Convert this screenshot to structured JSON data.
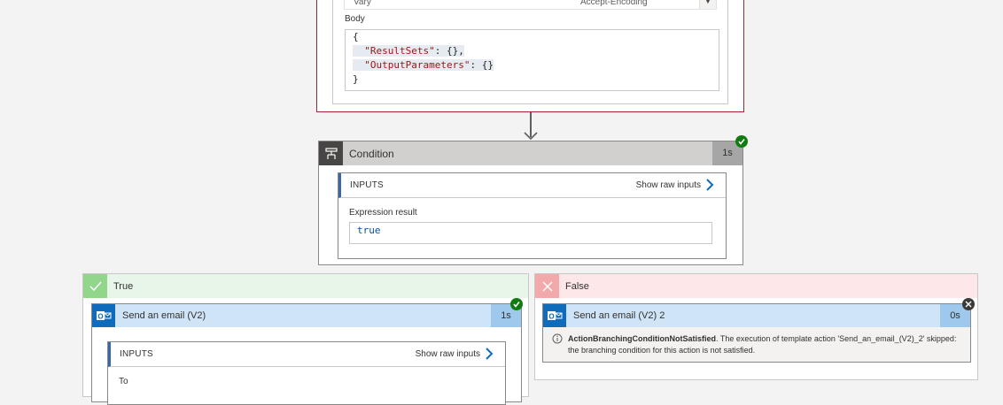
{
  "top_action": {
    "header_key": "Vary",
    "header_value": "Accept-Encoding",
    "body_label": "Body",
    "body_lines": [
      "{",
      "  \"ResultSets\": {},",
      "  \"OutputParameters\": {}",
      "}"
    ]
  },
  "condition": {
    "title": "Condition",
    "duration": "1s",
    "inputs_title": "INPUTS",
    "show_raw": "Show raw inputs",
    "expression_label": "Expression result",
    "expression_value": "true"
  },
  "true_branch": {
    "label": "True",
    "email_title": "Send an email (V2)",
    "duration": "1s",
    "inputs_title": "INPUTS",
    "show_raw": "Show raw inputs",
    "to_label": "To"
  },
  "false_branch": {
    "label": "False",
    "email_title": "Send an email (V2) 2",
    "duration": "0s",
    "error_code": "ActionBranchingConditionNotSatisfied",
    "error_message": ". The execution of template action 'Send_an_email_(V2)_2' skipped: the branching condition for this action is not satisfied."
  },
  "colors": {
    "failed_border": "#a4262c",
    "success": "#107c10",
    "skipped": "#3b3a39",
    "accent": "#0f6cbd"
  }
}
